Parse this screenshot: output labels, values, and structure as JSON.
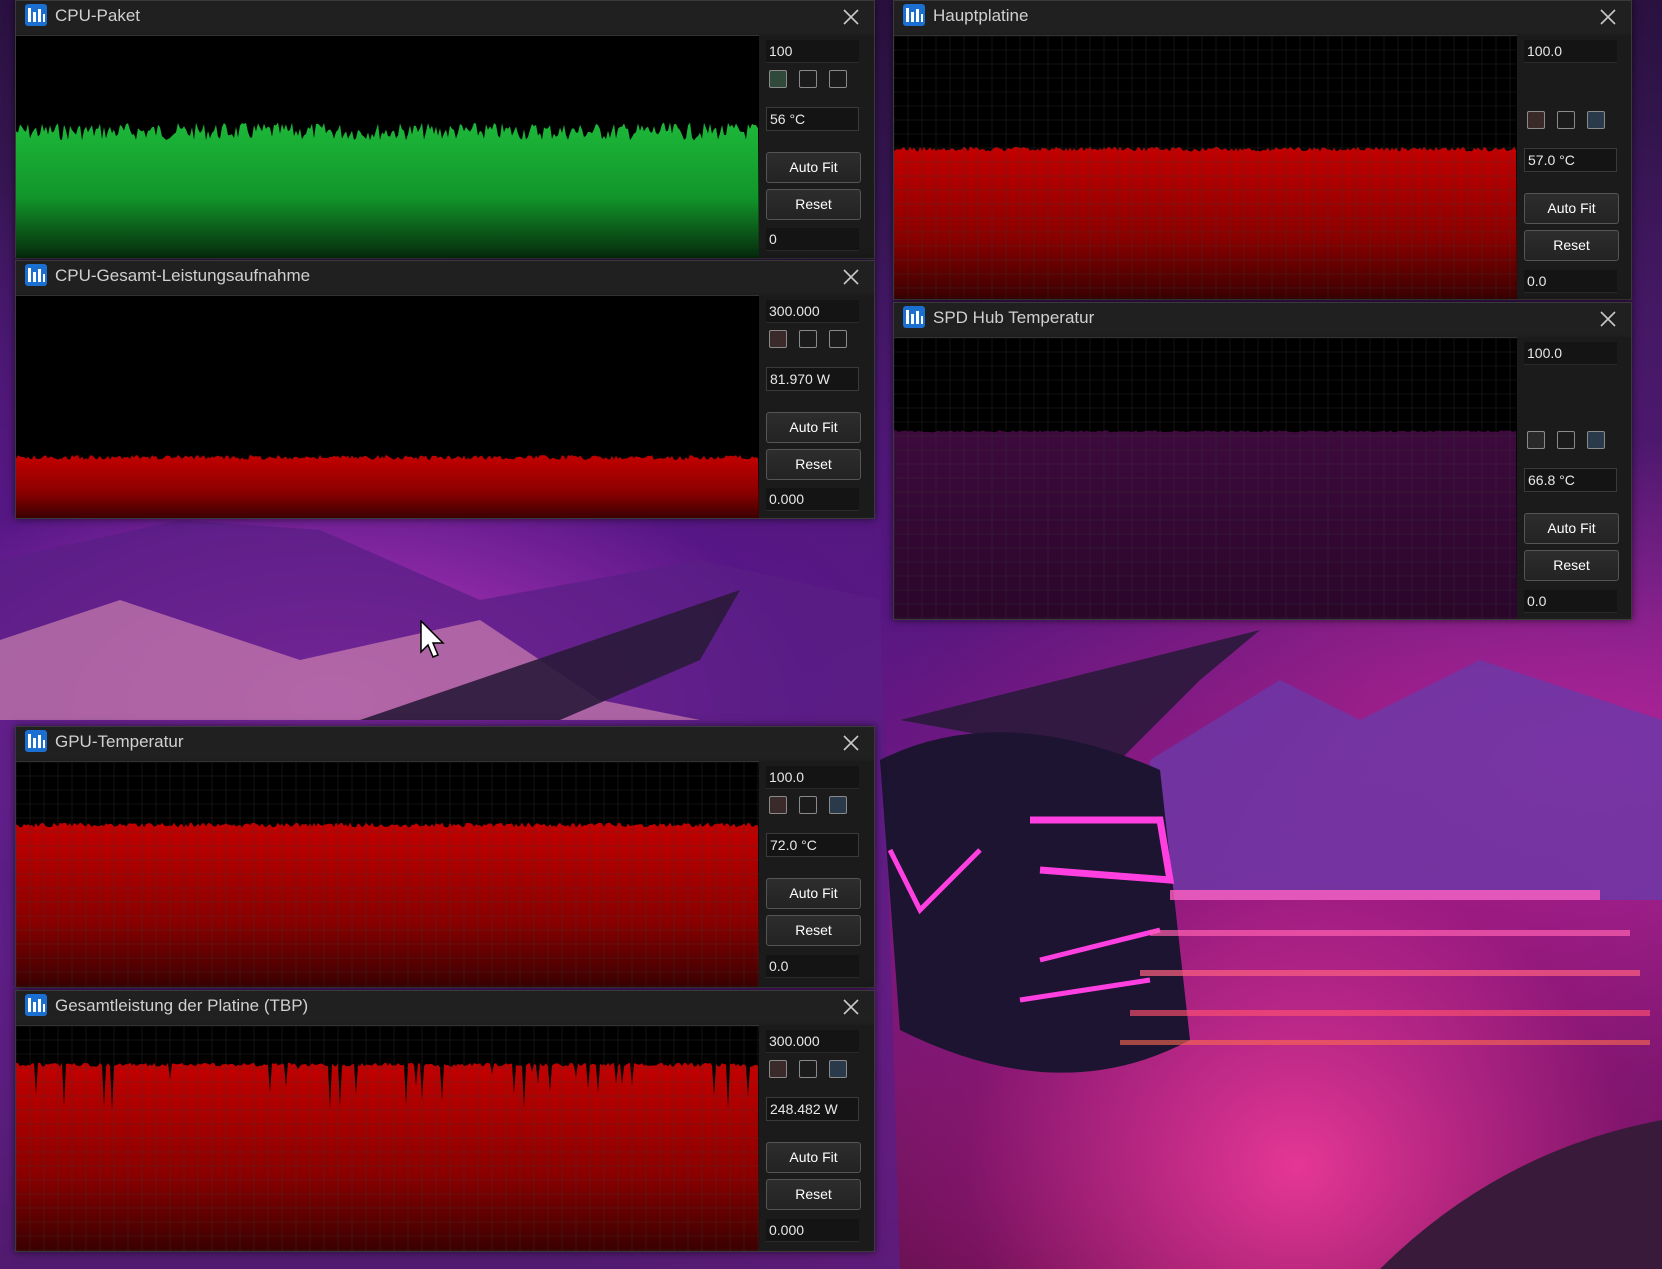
{
  "windows": [
    {
      "id": "w1",
      "title": "CPU-Paket",
      "max": "100",
      "current": "56 °C",
      "min": "0",
      "autofit_label": "Auto Fit",
      "reset_label": "Reset",
      "style": "green",
      "grid": false,
      "level": 0.57,
      "swatch_colors": [
        "#2f4a3a",
        "#1b1b1b",
        "#1b1b1b"
      ]
    },
    {
      "id": "w2",
      "title": "CPU-Gesamt-Leistungsaufnahme",
      "max": "300.000",
      "current": "81.970 W",
      "min": "0.000",
      "autofit_label": "Auto Fit",
      "reset_label": "Reset",
      "style": "red",
      "grid": false,
      "level": 0.273,
      "swatch_colors": [
        "#3a2a2a",
        "#1b1b1b",
        "#1b1b1b"
      ]
    },
    {
      "id": "w3",
      "title": "Hauptplatine",
      "max": "100.0",
      "current": "57.0 °C",
      "min": "0.0",
      "autofit_label": "Auto Fit",
      "reset_label": "Reset",
      "style": "red",
      "grid": true,
      "level": 0.57,
      "swatch_colors": [
        "#3a2a2a",
        "#1b1b1b",
        "#2a3a4a"
      ]
    },
    {
      "id": "w4",
      "title": "SPD Hub Temperatur",
      "max": "100.0",
      "current": "66.8 °C",
      "min": "0.0",
      "autofit_label": "Auto Fit",
      "reset_label": "Reset",
      "style": "purple",
      "grid": true,
      "level": 0.668,
      "swatch_colors": [
        "#2a2a2a",
        "#1b1b1b",
        "#2a3a4a"
      ]
    },
    {
      "id": "w5",
      "title": "GPU-Temperatur",
      "max": "100.0",
      "current": "72.0 °C",
      "min": "0.0",
      "autofit_label": "Auto Fit",
      "reset_label": "Reset",
      "style": "red",
      "grid": true,
      "level": 0.72,
      "swatch_colors": [
        "#3a2a2a",
        "#1b1b1b",
        "#2a3a4a"
      ]
    },
    {
      "id": "w6",
      "title": "Gesamtleistung der Platine (TBP)",
      "max": "300.000",
      "current": "248.482 W",
      "min": "0.000",
      "autofit_label": "Auto Fit",
      "reset_label": "Reset",
      "style": "red",
      "grid": true,
      "level": 0.828,
      "swatch_colors": [
        "#3a2a2a",
        "#1b1b1b",
        "#2a3a4a"
      ]
    }
  ],
  "colors": {
    "green": "#16a830",
    "red": "#c00000",
    "purple": "#3a0a3a",
    "window_bg": "#1e1e1e"
  }
}
